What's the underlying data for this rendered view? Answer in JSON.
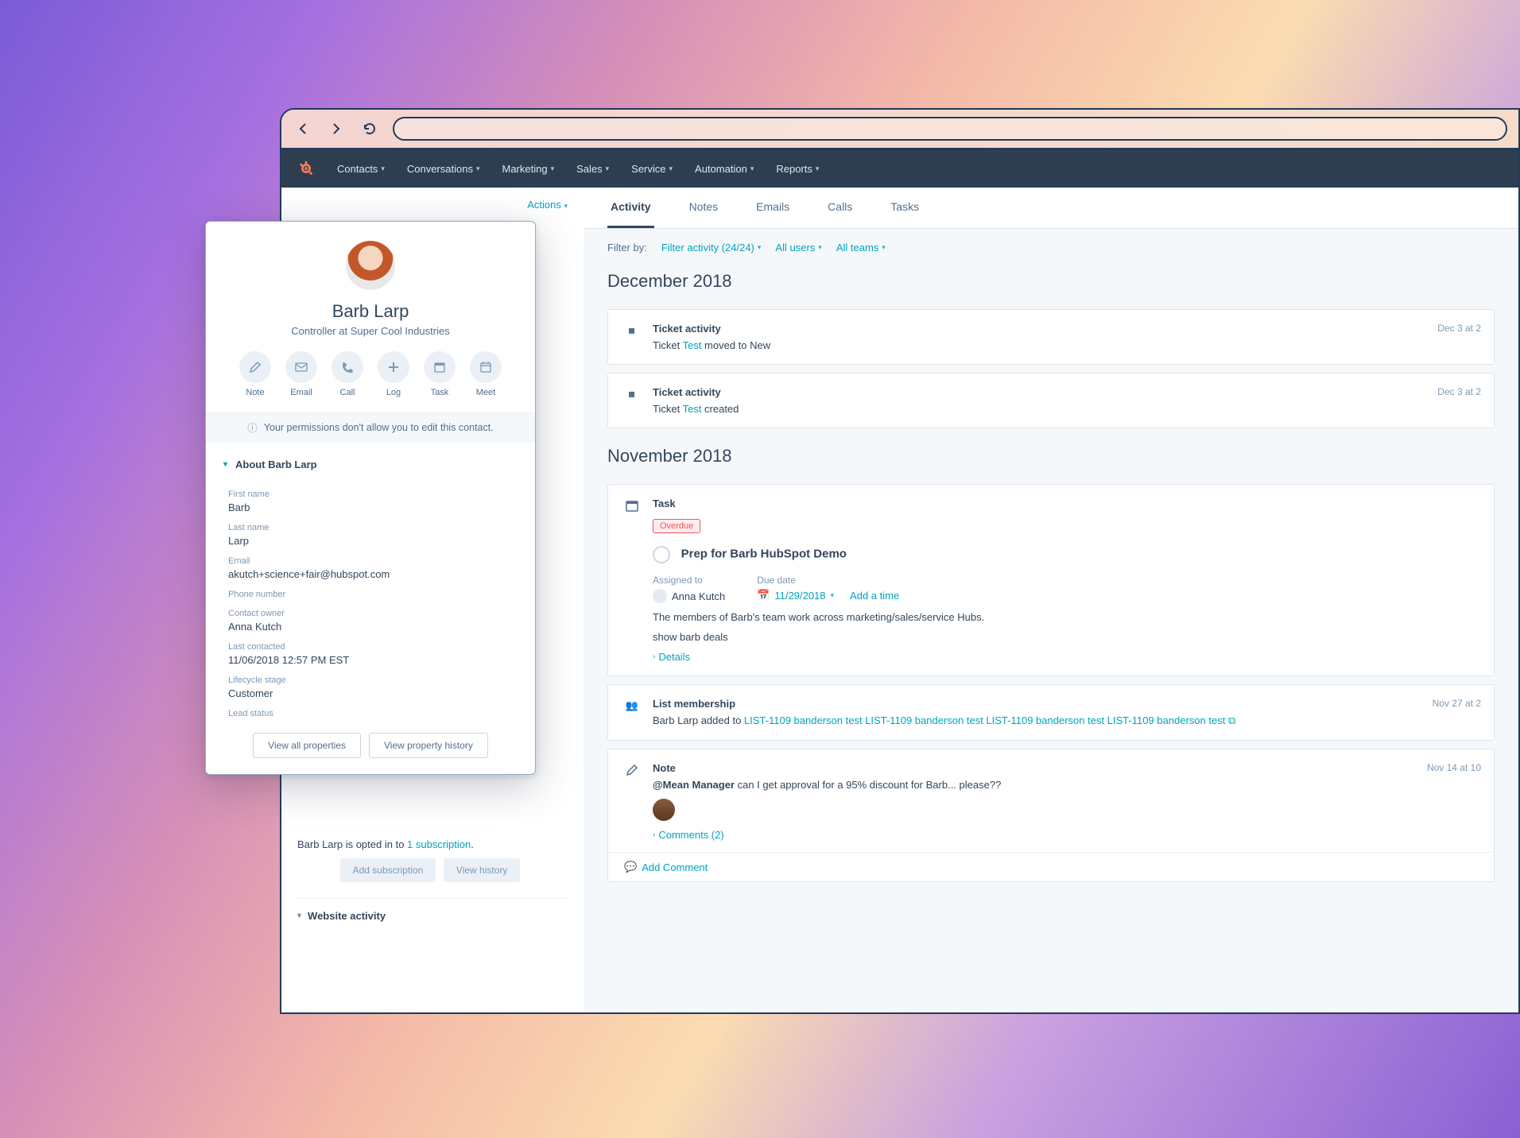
{
  "topnav": {
    "items": [
      "Contacts",
      "Conversations",
      "Marketing",
      "Sales",
      "Service",
      "Automation",
      "Reports"
    ]
  },
  "actions_label": "Actions",
  "tabs": [
    "Activity",
    "Notes",
    "Emails",
    "Calls",
    "Tasks"
  ],
  "active_tab": "Activity",
  "filter": {
    "label": "Filter by:",
    "activity": "Filter activity (24/24)",
    "users": "All users",
    "teams": "All teams"
  },
  "months": {
    "dec": "December 2018",
    "nov": "November 2018"
  },
  "ticket1": {
    "title": "Ticket activity",
    "prefix": "Ticket ",
    "link": "Test",
    "suffix": " moved to New",
    "time": "Dec 3 at 2"
  },
  "ticket2": {
    "title": "Ticket activity",
    "prefix": "Ticket ",
    "link": "Test",
    "suffix": " created",
    "time": "Dec 3 at 2"
  },
  "task": {
    "title": "Task",
    "badge": "Overdue",
    "name": "Prep for Barb HubSpot Demo",
    "assigned_label": "Assigned to",
    "assigned_to": "Anna Kutch",
    "due_label": "Due date",
    "due_date": "11/29/2018",
    "add_time": "Add a time",
    "desc1": "The members of Barb's team work across marketing/sales/service Hubs.",
    "desc2": "show barb deals",
    "details": "Details"
  },
  "list": {
    "title": "List membership",
    "prefix": "Barb Larp added to ",
    "links": "LIST-1109 banderson test LIST-1109 banderson test LIST-1109 banderson test LIST-1109 banderson test",
    "time": "Nov 27 at 2"
  },
  "note": {
    "title": "Note",
    "mention": "@Mean Manager",
    "text": " can I get approval for a 95% discount for Barb... please??",
    "time": "Nov 14 at 10",
    "comments": "Comments (2)",
    "add_comment": "Add Comment"
  },
  "subscription": {
    "prefix": "Barb Larp is opted in to ",
    "link": "1 subscription",
    "suffix": ".",
    "add": "Add subscription",
    "history": "View history"
  },
  "website_section": "Website activity",
  "contact": {
    "name": "Barb Larp",
    "role": "Controller at Super Cool Industries",
    "actions": [
      "Note",
      "Email",
      "Call",
      "Log",
      "Task",
      "Meet"
    ],
    "permission": "Your permissions don't allow you to edit this contact.",
    "about_title": "About Barb Larp",
    "props": [
      {
        "label": "First name",
        "value": "Barb"
      },
      {
        "label": "Last name",
        "value": "Larp"
      },
      {
        "label": "Email",
        "value": "akutch+science+fair@hubspot.com"
      },
      {
        "label": "Phone number",
        "value": ""
      },
      {
        "label": "Contact owner",
        "value": "Anna Kutch"
      },
      {
        "label": "Last contacted",
        "value": "11/06/2018 12:57 PM EST"
      },
      {
        "label": "Lifecycle stage",
        "value": "Customer"
      },
      {
        "label": "Lead status",
        "value": ""
      }
    ],
    "view_all": "View all properties",
    "view_history": "View property history"
  }
}
